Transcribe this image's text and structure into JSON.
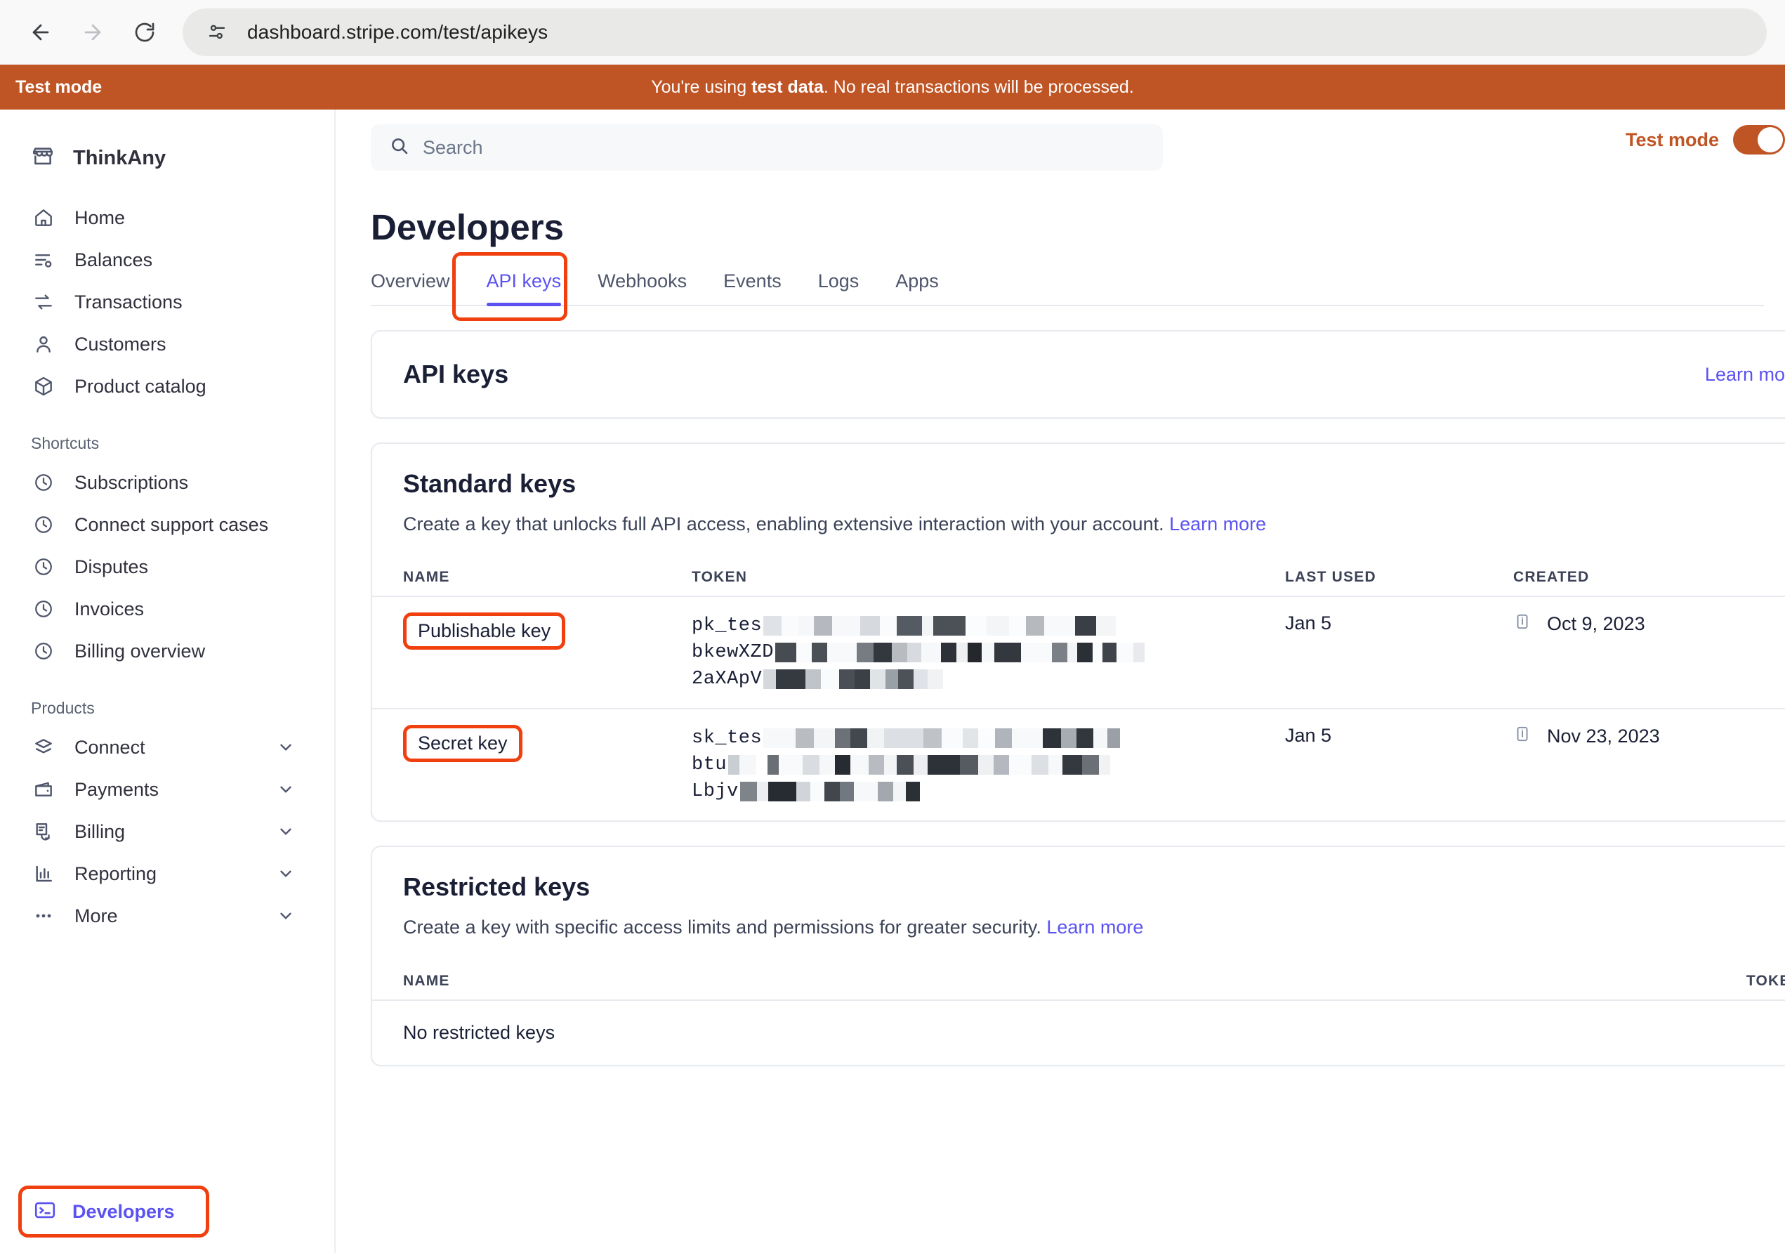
{
  "browser": {
    "url": "dashboard.stripe.com/test/apikeys",
    "back_icon": "back-arrow-icon",
    "forward_icon": "forward-arrow-icon",
    "reload_icon": "reload-icon",
    "site_info_icon": "site-settings-icon"
  },
  "banner": {
    "label": "Test mode",
    "message_prefix": "You're using ",
    "message_bold": "test data",
    "message_suffix": ". No real transactions will be processed.",
    "bg_color": "#bf5424"
  },
  "sidebar": {
    "brand": "ThinkAny",
    "brand_icon": "storefront-icon",
    "primary": [
      {
        "label": "Home",
        "icon": "home-icon"
      },
      {
        "label": "Balances",
        "icon": "balances-icon"
      },
      {
        "label": "Transactions",
        "icon": "transactions-icon"
      },
      {
        "label": "Customers",
        "icon": "customers-icon"
      },
      {
        "label": "Product catalog",
        "icon": "product-catalog-icon"
      }
    ],
    "shortcuts_label": "Shortcuts",
    "shortcuts": [
      {
        "label": "Subscriptions",
        "icon": "clock-icon"
      },
      {
        "label": "Connect support cases",
        "icon": "clock-icon"
      },
      {
        "label": "Disputes",
        "icon": "clock-icon"
      },
      {
        "label": "Invoices",
        "icon": "clock-icon"
      },
      {
        "label": "Billing overview",
        "icon": "clock-icon"
      }
    ],
    "products_label": "Products",
    "products": [
      {
        "label": "Connect",
        "icon": "layers-icon",
        "chevron": "chevron-down-icon"
      },
      {
        "label": "Payments",
        "icon": "wallet-icon",
        "chevron": "chevron-down-icon"
      },
      {
        "label": "Billing",
        "icon": "billing-icon",
        "chevron": "chevron-down-icon"
      },
      {
        "label": "Reporting",
        "icon": "bar-chart-icon",
        "chevron": "chevron-down-icon"
      },
      {
        "label": "More",
        "icon": "ellipsis-icon",
        "chevron": "chevron-down-icon"
      }
    ],
    "developers": {
      "label": "Developers",
      "icon": "terminal-icon",
      "color": "#5b52f0",
      "highlighted": true
    }
  },
  "topbar": {
    "search_placeholder": "Search",
    "search_value": "",
    "search_icon": "search-icon",
    "test_mode_label": "Test mode",
    "test_mode_on": true,
    "accent_color": "#bf5424"
  },
  "page": {
    "title": "Developers",
    "tabs": [
      {
        "label": "Overview",
        "active": false
      },
      {
        "label": "API keys",
        "active": true,
        "highlighted": true
      },
      {
        "label": "Webhooks",
        "active": false
      },
      {
        "label": "Events",
        "active": false
      },
      {
        "label": "Logs",
        "active": false
      },
      {
        "label": "Apps",
        "active": false
      }
    ],
    "active_tab_color": "#5b52f0"
  },
  "api_keys_card": {
    "title": "API keys",
    "learn_more": "Learn more"
  },
  "standard_keys": {
    "title": "Standard keys",
    "description": "Create a key that unlocks full API access, enabling extensive interaction with your account. ",
    "learn_more": "Learn more",
    "columns": [
      "NAME",
      "TOKEN",
      "LAST USED",
      "CREATED"
    ],
    "rows": [
      {
        "name": "Publishable key",
        "name_highlighted": true,
        "token_lines": [
          "pk_tes",
          "bkewXZD",
          "2aXApV"
        ],
        "token_redacted": true,
        "last_used": "Jan 5",
        "created": "Oct 9, 2023",
        "created_icon": "info-icon"
      },
      {
        "name": "Secret key",
        "name_highlighted": true,
        "token_lines": [
          "sk_tes",
          "btu",
          "Lbjv"
        ],
        "token_redacted": true,
        "last_used": "Jan 5",
        "created": "Nov 23, 2023",
        "created_icon": "info-icon"
      }
    ]
  },
  "restricted_keys": {
    "title": "Restricted keys",
    "description": "Create a key with specific access limits and permissions for greater security. ",
    "learn_more": "Learn more",
    "columns": [
      "NAME",
      "TOKEN"
    ],
    "empty_text": "No restricted keys"
  }
}
